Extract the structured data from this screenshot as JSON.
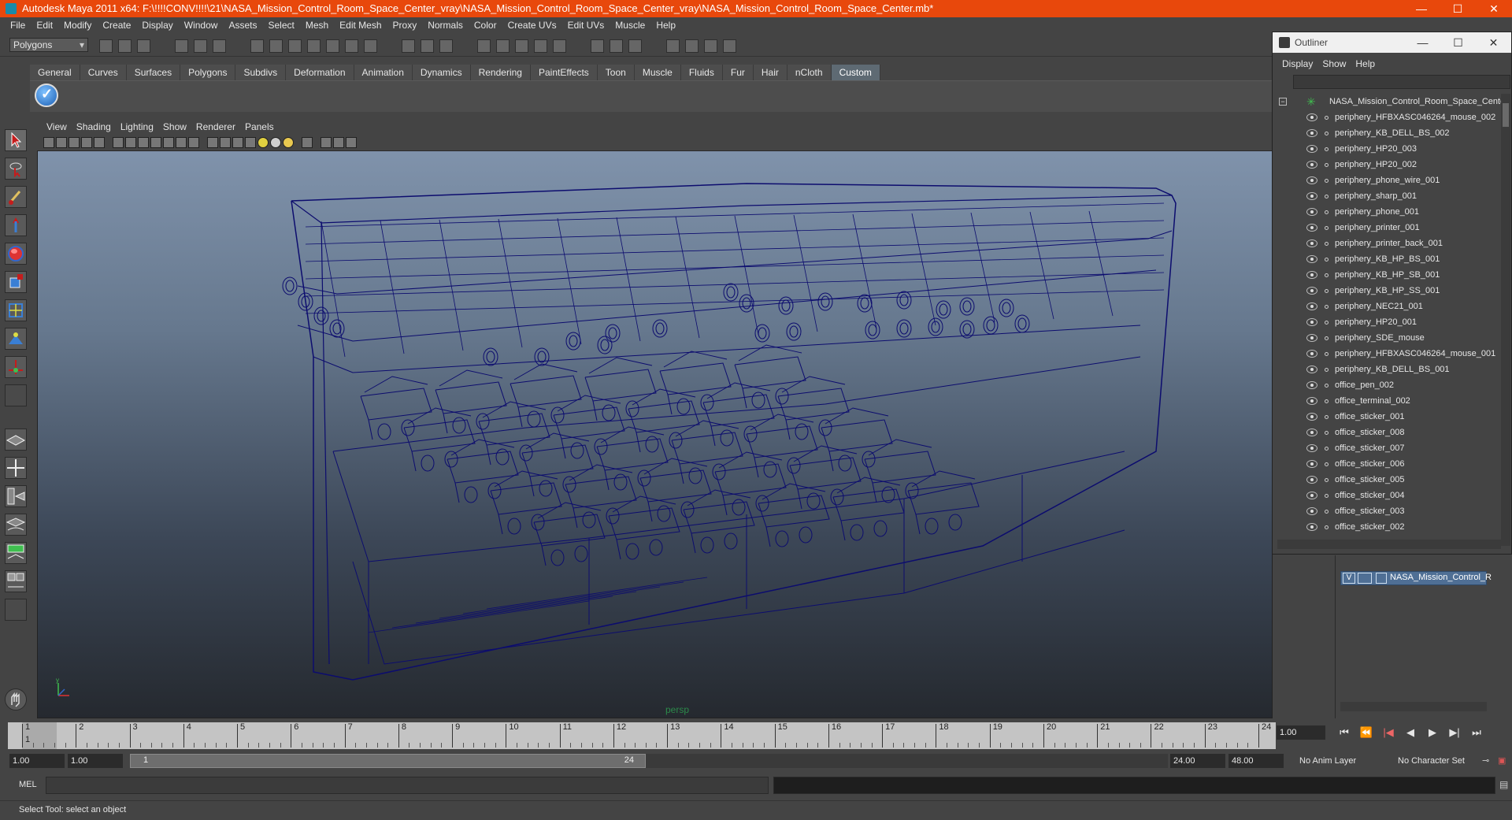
{
  "window": {
    "title": "Autodesk Maya 2011 x64: F:\\!!!!CONV!!!!\\21\\NASA_Mission_Control_Room_Space_Center_vray\\NASA_Mission_Control_Room_Space_Center_vray\\NASA_Mission_Control_Room_Space_Center.mb*",
    "minimize": "—",
    "maximize": "☐",
    "close": "✕"
  },
  "menubar": [
    "File",
    "Edit",
    "Modify",
    "Create",
    "Display",
    "Window",
    "Assets",
    "Select",
    "Mesh",
    "Edit Mesh",
    "Proxy",
    "Normals",
    "Color",
    "Create UVs",
    "Edit UVs",
    "Muscle",
    "Help"
  ],
  "statusline": {
    "mode": "Polygons"
  },
  "shelf": {
    "tabs": [
      "General",
      "Curves",
      "Surfaces",
      "Polygons",
      "Subdivs",
      "Deformation",
      "Animation",
      "Dynamics",
      "Rendering",
      "PaintEffects",
      "Toon",
      "Muscle",
      "Fluids",
      "Fur",
      "Hair",
      "nCloth",
      "Custom"
    ],
    "active_tab": "Custom"
  },
  "viewport": {
    "menu": [
      "View",
      "Shading",
      "Lighting",
      "Show",
      "Renderer",
      "Panels"
    ],
    "camera": "persp",
    "wire_color": "#0c0c6e"
  },
  "outliner": {
    "title": "Outliner",
    "menu": [
      "Display",
      "Show",
      "Help"
    ],
    "root": "NASA_Mission_Control_Room_Space_Center",
    "items": [
      "periphery_HFBXASC046264_mouse_002",
      "periphery_KB_DELL_BS_002",
      "periphery_HP20_003",
      "periphery_HP20_002",
      "periphery_phone_wire_001",
      "periphery_sharp_001",
      "periphery_phone_001",
      "periphery_printer_001",
      "periphery_printer_back_001",
      "periphery_KB_HP_BS_001",
      "periphery_KB_HP_SB_001",
      "periphery_KB_HP_SS_001",
      "periphery_NEC21_001",
      "periphery_HP20_001",
      "periphery_SDE_mouse",
      "periphery_HFBXASC046264_mouse_001",
      "periphery_KB_DELL_BS_001",
      "office_pen_002",
      "office_terminal_002",
      "office_sticker_001",
      "office_sticker_008",
      "office_sticker_007",
      "office_sticker_006",
      "office_sticker_005",
      "office_sticker_004",
      "office_sticker_003",
      "office_sticker_002"
    ]
  },
  "layers": {
    "visible_flag": "V",
    "name": "NASA_Mission_Control_R"
  },
  "timeslider": {
    "ticks": [
      1,
      2,
      3,
      4,
      5,
      6,
      7,
      8,
      9,
      10,
      11,
      12,
      13,
      14,
      15,
      16,
      17,
      18,
      19,
      20,
      21,
      22,
      23,
      24
    ],
    "current_marker": "1",
    "current_frame": "1.00"
  },
  "range": {
    "start": "1.00",
    "current": "1.00",
    "slider_start": "1",
    "slider_end": "24",
    "end": "24.00",
    "max": "48.00",
    "anim_layer": "No Anim Layer",
    "character_set": "No Character Set"
  },
  "command": {
    "label": "MEL"
  },
  "help": {
    "text": "Select Tool: select an object"
  },
  "colors": {
    "title_bar": "#e8480c",
    "active_tab": "#5e6a73",
    "layer_row": "#4f6f95"
  }
}
